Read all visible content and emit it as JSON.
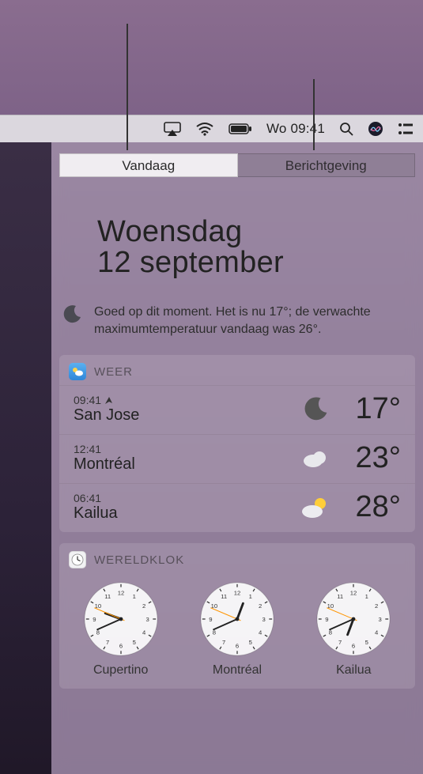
{
  "menubar": {
    "clock_text": "Wo 09:41"
  },
  "tabs": {
    "today": "Vandaag",
    "notifications": "Berichtgeving"
  },
  "date": {
    "day_name": "Woensdag",
    "date_line": "12 september"
  },
  "summary": {
    "text": "Goed op dit moment. Het is nu 17°; de verwachte maximumtemperatuur vandaag was 26°."
  },
  "weather": {
    "title": "WEER",
    "rows": [
      {
        "time": "09:41",
        "is_current": true,
        "city": "San Jose",
        "condition": "moon",
        "temp": "17°"
      },
      {
        "time": "12:41",
        "is_current": false,
        "city": "Montréal",
        "condition": "cloud",
        "temp": "23°"
      },
      {
        "time": "06:41",
        "is_current": false,
        "city": "Kailua",
        "condition": "partly-sun",
        "temp": "28°"
      }
    ]
  },
  "worldclock": {
    "title": "WERELDKLOK",
    "clocks": [
      {
        "city": "Cupertino",
        "hours": 9,
        "minutes": 41
      },
      {
        "city": "Montréal",
        "hours": 12,
        "minutes": 41
      },
      {
        "city": "Kailua",
        "hours": 6,
        "minutes": 41
      }
    ]
  }
}
